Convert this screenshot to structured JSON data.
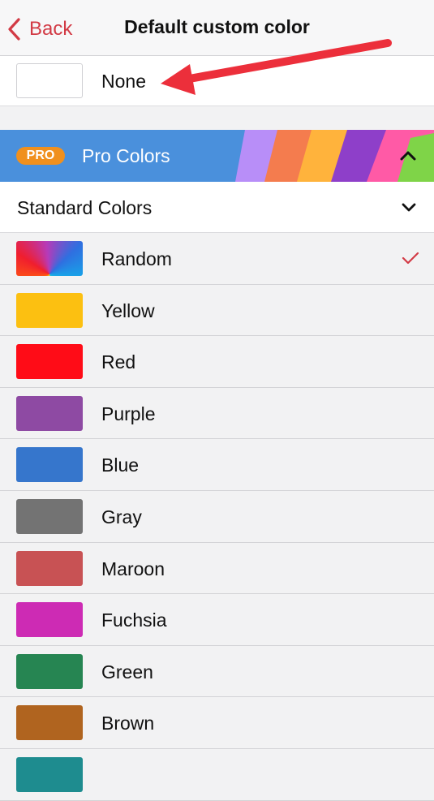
{
  "nav": {
    "back_label": "Back",
    "title": "Default custom color"
  },
  "none_row": {
    "label": "None"
  },
  "pro": {
    "badge": "PRO",
    "label": "Pro Colors",
    "expanded": false
  },
  "standard": {
    "label": "Standard Colors",
    "expanded": true
  },
  "colors": [
    {
      "label": "Random",
      "color": "random",
      "selected": true
    },
    {
      "label": "Yellow",
      "color": "#fcc011",
      "selected": false
    },
    {
      "label": "Red",
      "color": "#ff0c17",
      "selected": false
    },
    {
      "label": "Purple",
      "color": "#8e4aa3",
      "selected": false
    },
    {
      "label": "Blue",
      "color": "#3676cc",
      "selected": false
    },
    {
      "label": "Gray",
      "color": "#737373",
      "selected": false
    },
    {
      "label": "Maroon",
      "color": "#c85254",
      "selected": false
    },
    {
      "label": "Fuchsia",
      "color": "#cd2bb4",
      "selected": false
    },
    {
      "label": "Green",
      "color": "#268552",
      "selected": false
    },
    {
      "label": "Brown",
      "color": "#b0641f",
      "selected": false
    },
    {
      "label": "",
      "color": "#1e8c8f",
      "selected": false
    }
  ],
  "accent": "#d23a45"
}
